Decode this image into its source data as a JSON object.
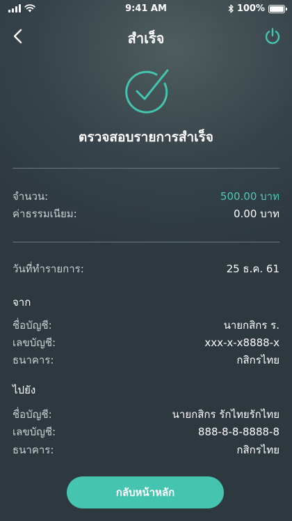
{
  "status_bar": {
    "time": "9:41 AM",
    "battery": "100%",
    "icons": [
      "signal-icon",
      "wifi-icon",
      "bluetooth-icon",
      "battery-icon"
    ]
  },
  "header": {
    "title": "สำเร็จ",
    "back_icon": "chevron-left-icon",
    "power_icon": "power-icon"
  },
  "success": {
    "icon": "check-circle-icon",
    "title": "ตรวจสอบรายการสำเร็จ"
  },
  "summary": {
    "amount_label": "จำนวน:",
    "amount_value": "500.00 บาท",
    "fee_label": "ค่าธรรมเนียม:",
    "fee_value": "0.00 บาท"
  },
  "transaction": {
    "date_label": "วันที่ทำรายการ:",
    "date_value": "25 ธ.ค. 61"
  },
  "from": {
    "heading": "จาก",
    "name_label": "ชื่อบัญชี:",
    "name_value": "นายกสิกร ร.",
    "account_label": "เลขบัญชี:",
    "account_value": "xxx-x-x8888-x",
    "bank_label": "ธนาคาร:",
    "bank_value": "กสิกรไทย"
  },
  "to": {
    "heading": "ไปยัง",
    "name_label": "ชื่อบัญชี:",
    "name_value": "นายกสิกร รักไทยรักไทย",
    "account_label": "เลขบัญชี:",
    "account_value": "888-8-8-8888-8",
    "bank_label": "ธนาคาร:",
    "bank_value": "กสิกรไทย"
  },
  "footer": {
    "home_button_label": "กลับหน้าหลัก"
  },
  "colors": {
    "accent": "#45c4b0",
    "amount": "#4fc9b4",
    "background": "#36434a"
  }
}
